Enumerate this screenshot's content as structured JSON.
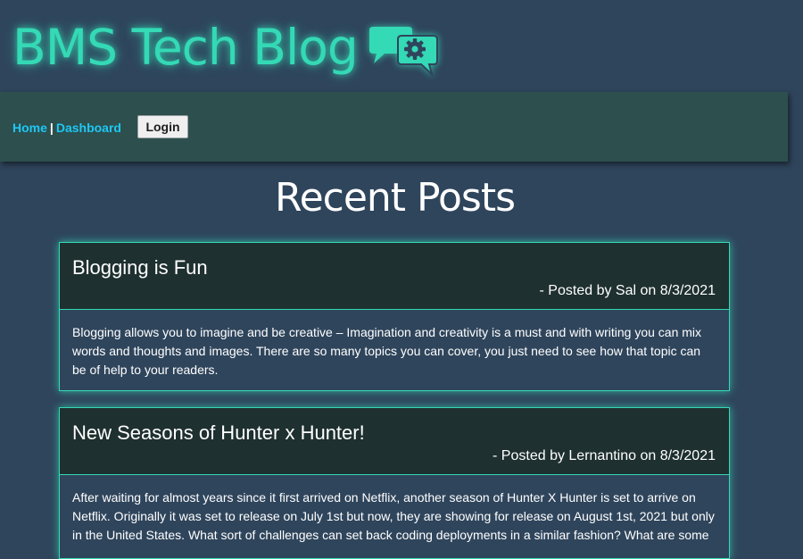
{
  "header": {
    "site_title": "BMS Tech Blog",
    "logo_icon": "chat-bubbles-gear-icon",
    "accent_color": "#34d9b5"
  },
  "nav": {
    "home_label": "Home",
    "separator": "|",
    "dashboard_label": "Dashboard",
    "login_label": "Login",
    "link_color": "#1fc7f4"
  },
  "main": {
    "page_title": "Recent Posts",
    "posts": [
      {
        "title": "Blogging is Fun",
        "meta": "- Posted by Sal on 8/3/2021",
        "body": "Blogging allows you to imagine and be creative – Imagination and creativity is a must and with writing you can mix words and thoughts and images. There are so many topics you can cover, you just need to see how that topic can be of help to your readers."
      },
      {
        "title": "New Seasons of Hunter x Hunter!",
        "meta": "- Posted by Lernantino on 8/3/2021",
        "body": "After waiting for almost years since it first arrived on Netflix, another season of Hunter X Hunter is set to arrive on Netflix. Originally it was set to release on July 1st but now, they are showing for release on August 1st, 2021 but only in the United States. What sort of challenges can set back coding deployments in a similar fashion? What are some"
      }
    ]
  },
  "colors": {
    "page_background": "#2f455c",
    "navbar_background": "#2d4f4d",
    "post_header_background": "#1e302f"
  }
}
